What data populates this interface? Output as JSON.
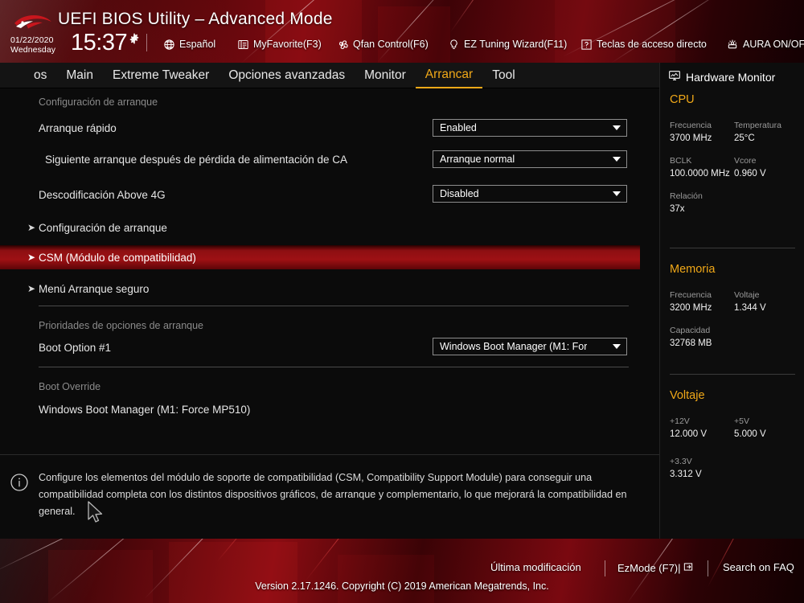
{
  "header": {
    "title": "UEFI BIOS Utility – Advanced Mode",
    "logo_name": "rog-logo",
    "date": "01/22/2020",
    "weekday": "Wednesday",
    "time": "15:37",
    "items": [
      {
        "label": "Español",
        "icon": "globe-icon"
      },
      {
        "label": "MyFavorite(F3)",
        "icon": "list-icon"
      },
      {
        "label": "Qfan Control(F6)",
        "icon": "fan-icon"
      },
      {
        "label": "EZ Tuning Wizard(F11)",
        "icon": "bulb-icon"
      },
      {
        "label": "Teclas de acceso directo",
        "icon": "question-icon"
      },
      {
        "label": "AURA ON/OFF",
        "icon": "aura-icon"
      }
    ]
  },
  "tabs": [
    {
      "label": "os",
      "active": false
    },
    {
      "label": "Main",
      "active": false
    },
    {
      "label": "Extreme Tweaker",
      "active": false
    },
    {
      "label": "Opciones avanzadas",
      "active": false
    },
    {
      "label": "Monitor",
      "active": false
    },
    {
      "label": "Arrancar",
      "active": true
    },
    {
      "label": "Tool",
      "active": false
    }
  ],
  "main": {
    "section_boot_config": "Configuración de arranque",
    "settings": [
      {
        "label": "Arranque rápido",
        "value": "Enabled"
      },
      {
        "label": "Siguiente arranque después de pérdida de alimentación de CA",
        "value": "Arranque normal"
      },
      {
        "label": "Descodificación Above 4G",
        "value": "Disabled"
      }
    ],
    "submenus": [
      {
        "label": "Configuración de arranque",
        "selected": false
      },
      {
        "label": "CSM (Módulo de compatibilidad)",
        "selected": true
      },
      {
        "label": "Menú Arranque seguro",
        "selected": false
      }
    ],
    "section_boot_priorities": "Prioridades de opciones de arranque",
    "boot_option": {
      "label": "Boot Option #1",
      "value": "Windows Boot Manager (M1: For"
    },
    "section_boot_override": "Boot Override",
    "boot_override_items": [
      "Windows Boot Manager (M1: Force MP510)"
    ],
    "help_text": "Configure los elementos del módulo de soporte de compatibilidad (CSM, Compatibility Support Module) para conseguir una compatibilidad completa con los distintos dispositivos gráficos, de arranque y complementario, lo que mejorará la compatibilidad en general."
  },
  "sidebar": {
    "title": "Hardware Monitor",
    "sections": [
      {
        "name": "CPU",
        "fields": [
          {
            "key": "Frecuencia",
            "value": "3700 MHz"
          },
          {
            "key": "Temperatura",
            "value": "25°C"
          },
          {
            "key": "BCLK",
            "value": "100.0000 MHz"
          },
          {
            "key": "Vcore",
            "value": "0.960 V"
          },
          {
            "key": "Relación",
            "value": "37x"
          }
        ]
      },
      {
        "name": "Memoria",
        "fields": [
          {
            "key": "Frecuencia",
            "value": "3200 MHz"
          },
          {
            "key": "Voltaje",
            "value": "1.344 V"
          },
          {
            "key": "Capacidad",
            "value": "32768 MB"
          }
        ]
      },
      {
        "name": "Voltaje",
        "fields": [
          {
            "key": "+12V",
            "value": "12.000 V"
          },
          {
            "key": "+5V",
            "value": "5.000 V"
          },
          {
            "key": "+3.3V",
            "value": "3.312 V"
          }
        ]
      }
    ]
  },
  "footer": {
    "links": [
      {
        "label": "Última modificación"
      },
      {
        "label": "EzMode (F7)|"
      },
      {
        "label": "Search on FAQ"
      }
    ],
    "version": "Version 2.17.1246. Copyright (C) 2019 American Megatrends, Inc."
  },
  "colors": {
    "accent_amber": "#f0a818",
    "highlight_red": "#9e1114",
    "panel_bg": "#0b0b0b"
  }
}
